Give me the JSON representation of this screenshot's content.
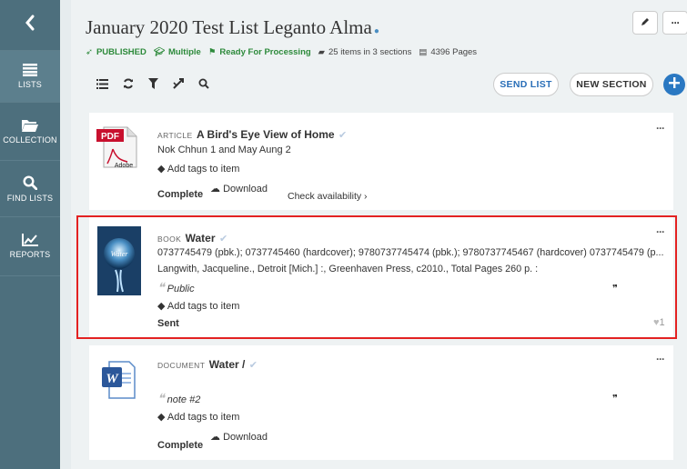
{
  "sidebar": {
    "items": [
      {
        "label": "LISTS",
        "icon": "list-icon"
      },
      {
        "label": "COLLECTION",
        "icon": "folder-icon"
      },
      {
        "label": "FIND LISTS",
        "icon": "search-icon"
      },
      {
        "label": "REPORTS",
        "icon": "chart-icon"
      }
    ]
  },
  "header": {
    "title": "January 2020 Test List Leganto Alma",
    "published": "PUBLISHED",
    "audience": "Multiple",
    "status": "Ready For Processing",
    "items_summary": "25 items in 3 sections",
    "pages": "4396 Pages"
  },
  "toolbar": {
    "send_list": "SEND LIST",
    "new_section": "NEW SECTION"
  },
  "items": [
    {
      "kind": "ARTICLE",
      "title": "A Bird's Eye View of Home",
      "authors": "Nok Chhun 1 and May Aung 2",
      "add_tags": "Add tags to item",
      "download": "Download",
      "check_availability": "Check availability ›",
      "status": "Complete",
      "thumb_label": "PDF",
      "thumb_brand": "Adobe"
    },
    {
      "kind": "BOOK",
      "title": "Water",
      "identifiers": "0737745479 (pbk.); 0737745460 (hardcover); 9780737745474 (pbk.); 9780737745467 (hardcover) 0737745479 (p...",
      "publication": "Langwith, Jacqueline., Detroit [Mich.] :, Greenhaven Press, c2010., Total Pages 260 p. :",
      "note": "Public",
      "add_tags": "Add tags to item",
      "status": "Sent",
      "likes": "1",
      "thumb_label": "Water"
    },
    {
      "kind": "DOCUMENT",
      "title": "Water /",
      "note": "note #2",
      "add_tags": "Add tags to item",
      "download": "Download",
      "status": "Complete",
      "thumb_label": "W"
    }
  ]
}
